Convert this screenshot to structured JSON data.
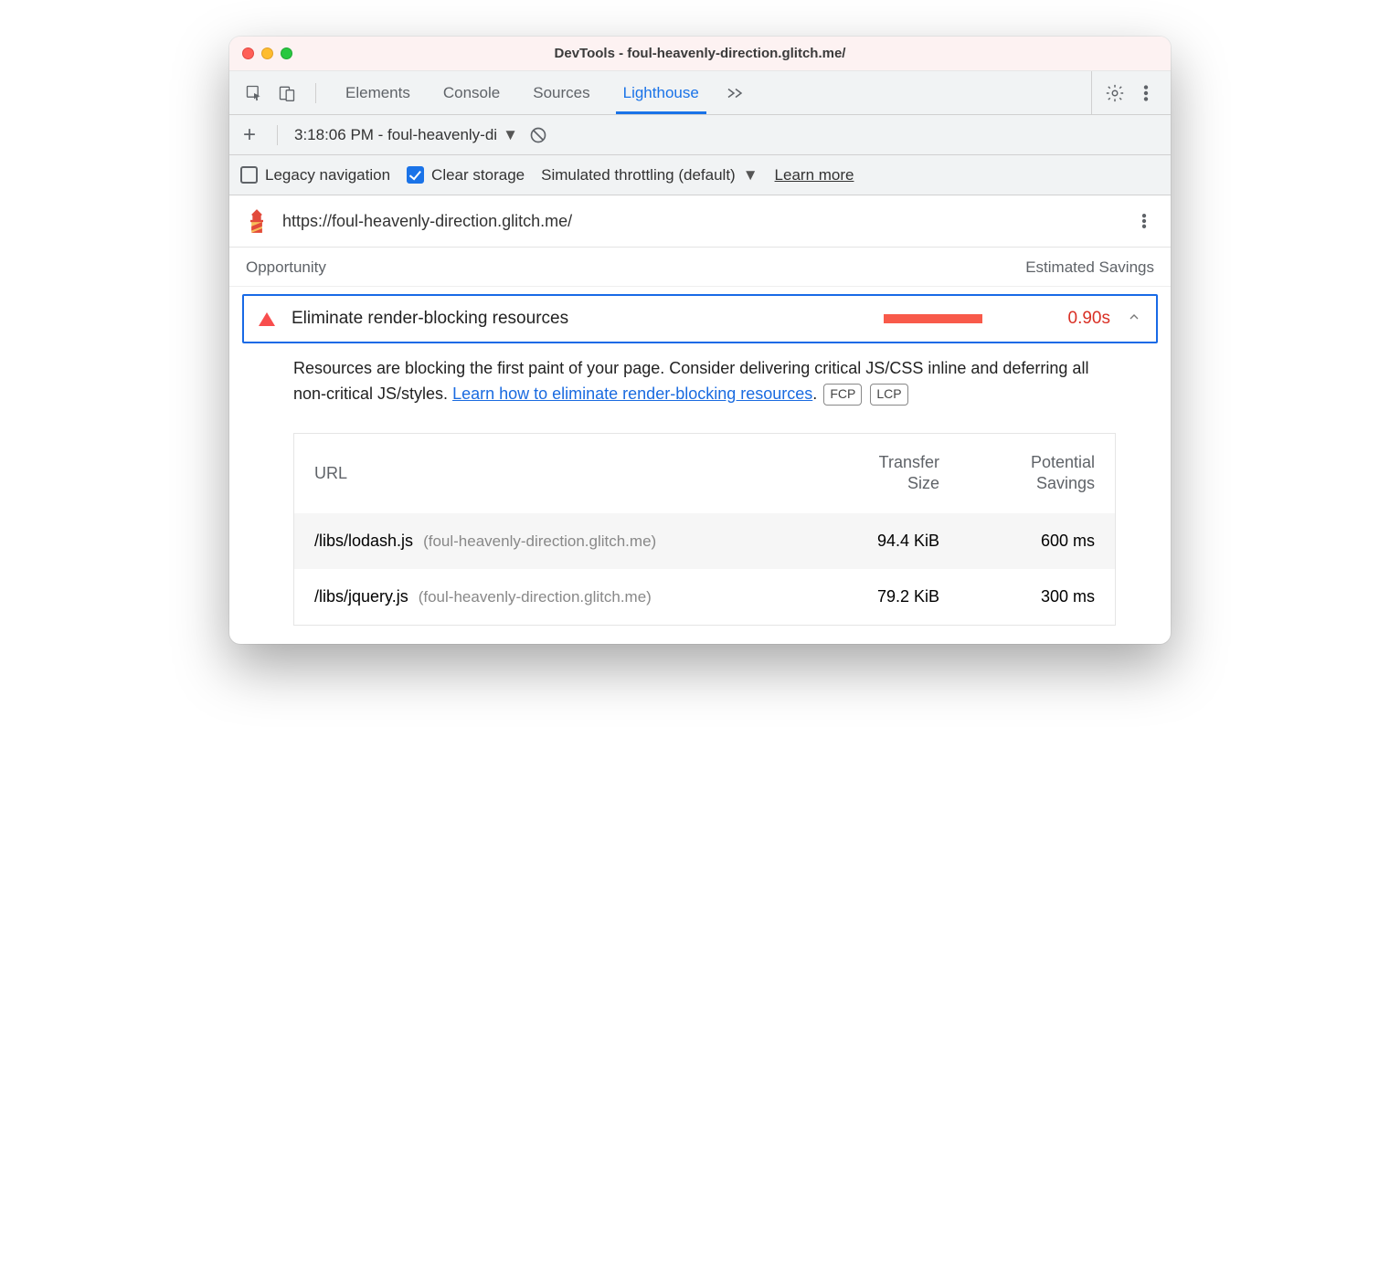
{
  "window": {
    "title": "DevTools - foul-heavenly-direction.glitch.me/"
  },
  "tabs": {
    "items": [
      "Elements",
      "Console",
      "Sources",
      "Lighthouse"
    ],
    "active": "Lighthouse"
  },
  "subbar": {
    "run_label": "3:18:06 PM - foul-heavenly-di"
  },
  "optbar": {
    "legacy_label": "Legacy navigation",
    "legacy_checked": false,
    "clear_label": "Clear storage",
    "clear_checked": true,
    "throttle_label": "Simulated throttling (default)",
    "learn_label": "Learn more"
  },
  "urlbar": {
    "url": "https://foul-heavenly-direction.glitch.me/"
  },
  "headers": {
    "opportunity": "Opportunity",
    "savings": "Estimated Savings"
  },
  "audit": {
    "title": "Eliminate render-blocking resources",
    "savings": "0.90s",
    "bar_pct": 72,
    "desc_pre": "Resources are blocking the first paint of your page. Consider delivering critical JS/CSS inline and deferring all non-critical JS/styles. ",
    "desc_link": "Learn how to eliminate render-blocking resources",
    "desc_post": ".",
    "tags": [
      "FCP",
      "LCP"
    ]
  },
  "table": {
    "col_url": "URL",
    "col_size_a": "Transfer",
    "col_size_b": "Size",
    "col_sav_a": "Potential",
    "col_sav_b": "Savings",
    "rows": [
      {
        "path": "/libs/lodash.js",
        "host": "(foul-heavenly-direction.glitch.me)",
        "size": "94.4 KiB",
        "savings": "600 ms"
      },
      {
        "path": "/libs/jquery.js",
        "host": "(foul-heavenly-direction.glitch.me)",
        "size": "79.2 KiB",
        "savings": "300 ms"
      }
    ]
  }
}
